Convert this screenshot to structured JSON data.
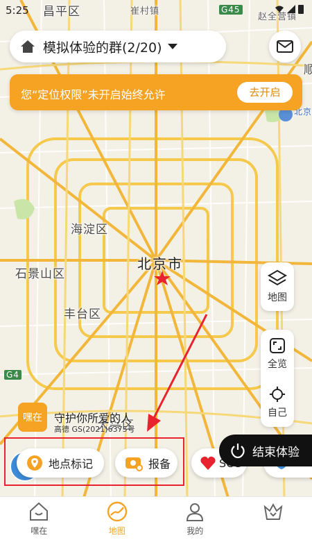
{
  "status_bar": {
    "time": "5:25"
  },
  "map": {
    "labels": {
      "changping": "昌平区",
      "cuicun": "崔村镇",
      "highway_g45": "G45",
      "zhaoquanying": "赵全营镇",
      "shunyi": "顺",
      "airport": "北京国际",
      "haidian": "海淀区",
      "beijing": "北京市",
      "shijingshan": "石景山区",
      "fengtai": "丰台区",
      "highway_g4": "G4",
      "daxing": "大兴区"
    }
  },
  "header": {
    "group_title": "模拟体验的群(2/20)"
  },
  "banner": {
    "text": "您“定位权限”未开启始终允许",
    "button": "去开启"
  },
  "map_controls": {
    "layers": "地图",
    "fit_all": "全览",
    "locate_self": "自己"
  },
  "brand": {
    "logo": "嘿在",
    "slogan": "守护你所爱的人",
    "copyright": "高德 GS(2021)6375号"
  },
  "actions": {
    "place_mark": "地点标记",
    "report_safe": "报备",
    "sos": "SOS",
    "end_experience": "结束体验"
  },
  "tabbar": {
    "tabs": [
      "嘿在",
      "地图",
      "我的"
    ],
    "active": "地图"
  },
  "colors": {
    "brand_orange": "#f6a324",
    "highlight_red": "#e8222e",
    "end_button": "#111111"
  }
}
